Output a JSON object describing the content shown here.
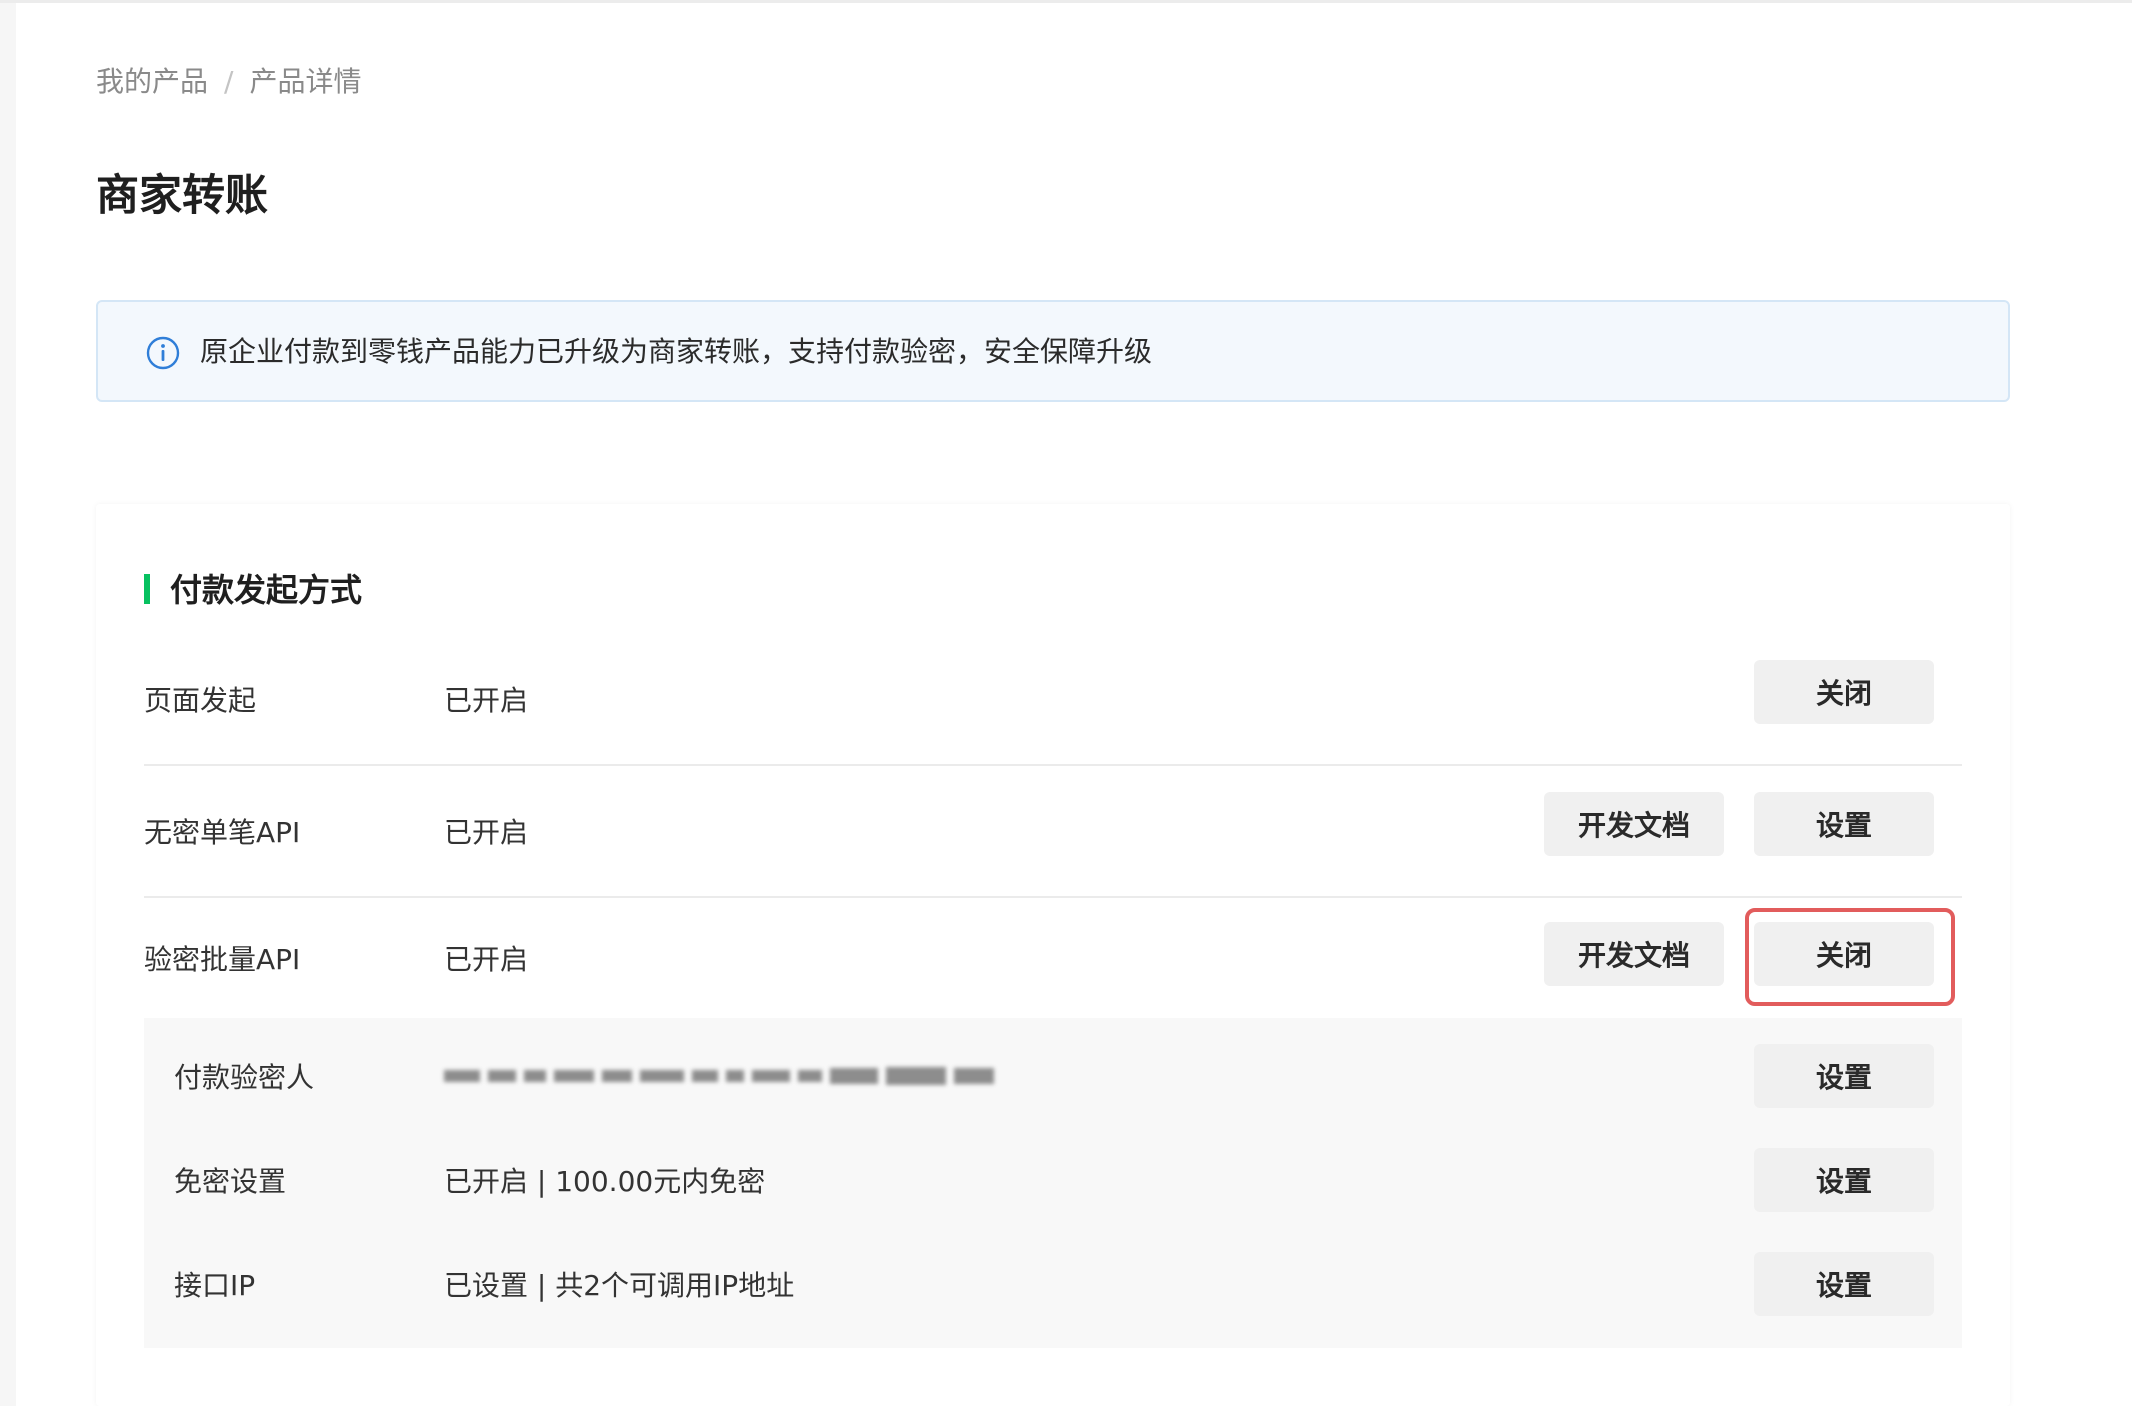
{
  "breadcrumb": {
    "items": [
      "我的产品",
      "产品详情"
    ],
    "separator": "/"
  },
  "page_title": "商家转账",
  "notice": {
    "icon": "info-icon",
    "text": "原企业付款到零钱产品能力已升级为商家转账，支持付款验密，安全保障升级"
  },
  "section": {
    "title": "付款发起方式",
    "accent_color": "#07c160",
    "rows": [
      {
        "label": "页面发起",
        "status": "已开启",
        "actions": [
          "关闭"
        ]
      },
      {
        "label": "无密单笔API",
        "status": "已开启",
        "actions": [
          "开发文档",
          "设置"
        ]
      },
      {
        "label": "验密批量API",
        "status": "已开启",
        "actions": [
          "开发文档",
          "关闭"
        ],
        "highlighted_action": "关闭",
        "highlight_color": "#e25c5c",
        "sub_items": [
          {
            "label": "付款验密人",
            "value_obscured": true,
            "action": "设置"
          },
          {
            "label": "免密设置",
            "value": "已开启 | 100.00元内免密",
            "action": "设置"
          },
          {
            "label": "接口IP",
            "value": "已设置 | 共2个可调用IP地址",
            "action": "设置"
          }
        ]
      }
    ]
  }
}
